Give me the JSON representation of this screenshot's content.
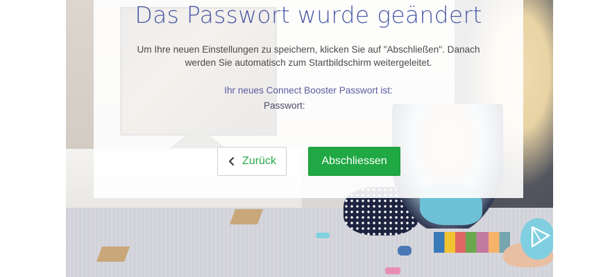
{
  "dialog": {
    "title": "Das Passwort wurde geändert",
    "info_line_1": "Um Ihre neuen Einstellungen zu speichern, klicken Sie auf \"Abschließen\". Danach",
    "info_line_2": "werden Sie automatisch zum Startbildschirm weitergeleitet.",
    "password_intro": "Ihr neues Connect Booster Passwort ist:",
    "password_label": "Passwort:",
    "password_value": ""
  },
  "buttons": {
    "back_label": "Zurück",
    "finish_label": "Abschliessen"
  },
  "icons": {
    "back": "chevron-left-icon",
    "corner": "play-triangle-icon"
  },
  "colors": {
    "title": "#4b5aa3",
    "accent_green": "#1fa843",
    "back_text": "#2aa84a"
  }
}
